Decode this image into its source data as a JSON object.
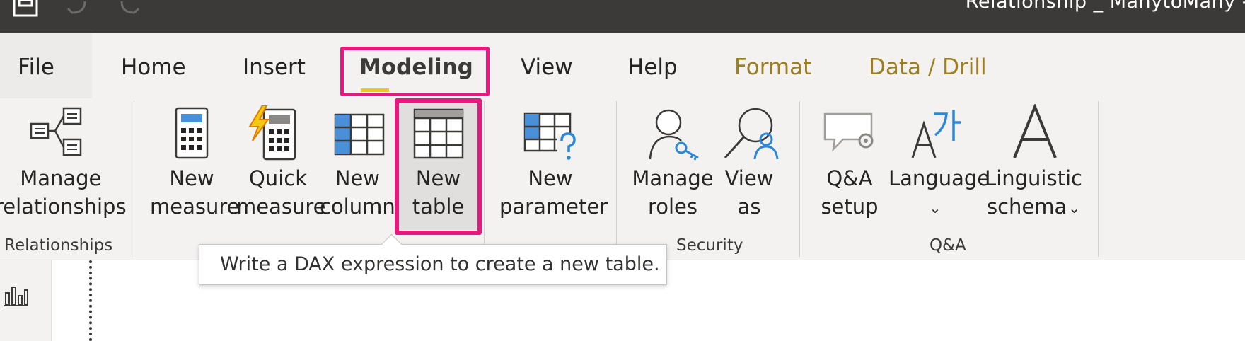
{
  "titlebar": {
    "window_title": "Relationship _ ManytoMany -",
    "icons": [
      "save-icon",
      "undo-icon",
      "redo-icon"
    ]
  },
  "menu": {
    "tabs": [
      {
        "label": "File"
      },
      {
        "label": "Home"
      },
      {
        "label": "Insert"
      },
      {
        "label": "Modeling",
        "active": true
      },
      {
        "label": "View"
      },
      {
        "label": "Help"
      },
      {
        "label": "Format",
        "contextual": true
      },
      {
        "label": "Data / Drill",
        "contextual": true
      }
    ]
  },
  "ribbon": {
    "groups": {
      "relationships": "Relationships",
      "security": "Security",
      "qna": "Q&A"
    },
    "buttons": {
      "manage_relationships": "Manage\nrelationships",
      "new_measure": "New\nmeasure",
      "quick_measure": "Quick\nmeasure",
      "new_column": "New\ncolumn",
      "new_table": "New\ntable",
      "new_parameter": "New\nparameter",
      "manage_roles": "Manage\nroles",
      "view_as": "View\nas",
      "qna_setup": "Q&A\nsetup",
      "language": "Language",
      "linguistic_schema_1": "Linguistic",
      "linguistic_schema_2": "schema"
    }
  },
  "tooltip": {
    "text": "Write a DAX expression to create a new table."
  },
  "colors": {
    "highlight": "#e8187f",
    "titlebar": "#3b3a39",
    "ribbon_bg": "#f3f2f1",
    "contextual_tab": "#9c7f20",
    "accent_blue": "#4a90d9",
    "accent_yellow": "#f2c811"
  }
}
